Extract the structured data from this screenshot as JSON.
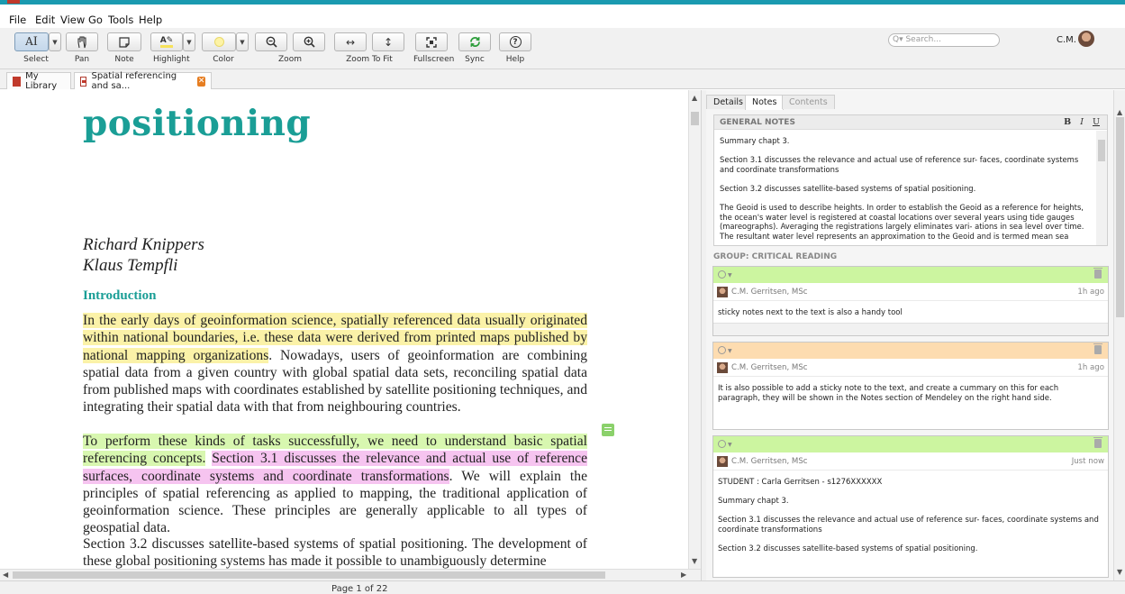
{
  "menu": [
    "File",
    "Edit",
    "View",
    "Go",
    "Tools",
    "Help"
  ],
  "toolbar": {
    "labels": {
      "select": "Select",
      "pan": "Pan",
      "note": "Note",
      "highlight": "Highlight",
      "color": "Color",
      "zoom": "Zoom",
      "zoom_to_fit": "Zoom To Fit",
      "fullscreen": "Fullscreen",
      "sync": "Sync",
      "help": "Help"
    },
    "search_placeholder": "Q▾ Search...",
    "user_initials": "C.M.",
    "colors": {
      "sync_icon": "#2e9e3c",
      "highlight_swatch": "#f7e25a",
      "color_swatch": "#fdf3a6"
    }
  },
  "tabs": {
    "library": "My Library",
    "document": "Spatial referencing and sa...",
    "close_glyph": "✕"
  },
  "document": {
    "title": "positioning",
    "author1": "Richard Knippers",
    "author2": "Klaus Tempfli",
    "heading": "Introduction",
    "p1_highlight": "In the early days of geoinformation science, spatially referenced data usually originated within national boundaries, i.e. these data were derived from printed maps published by national mapping organizations",
    "p1_rest": ". Nowadays, users of geoinformation are combining spatial data from a given country with global spatial data sets, reconciling spatial data from published maps with coordinates established by satellite positioning techniques, and integrating their spatial data with that from neighbouring countries.",
    "p2_green": "To perform these kinds of tasks successfully, we need to understand basic spatial referencing concepts.",
    "p2_pink": "Section 3.1 discusses the relevance and actual use of reference surfaces, coordinate systems and coordinate transformations",
    "p2_rest": ". We will explain the principles of spatial referencing as applied to mapping, the traditional application of geoinformation science. These principles are generally applicable to all types of geospatial data.",
    "p3": "Section 3.2 discusses satellite-based systems of spatial positioning. The development of these global positioning systems has made it possible to unambiguously determine",
    "highlight_colors": {
      "yellow": "#fbf2a8",
      "green": "#d8f7b0",
      "pink": "#f6c4f0"
    }
  },
  "status": {
    "page": "Page 1 of 22"
  },
  "sidebar": {
    "tabs": {
      "details": "Details",
      "notes": "Notes",
      "contents": "Contents"
    },
    "general_notes": {
      "title": "GENERAL NOTES",
      "format": {
        "bold": "B",
        "italic": "I",
        "underline": "U"
      },
      "lines": [
        "Summary chapt 3.",
        "Section 3.1 discusses the relevance and actual use of reference sur- faces, coordinate systems and coordinate transformations",
        "Section 3.2 discusses satellite-based systems of spatial positioning.",
        "The Geoid is used to describe heights. In order to establish the Geoid as a reference for heights, the ocean's water level is registered at coastal locations over several years using tide gauges (mareographs). Averaging the registrations largely eliminates vari- ations in sea level over time. The resultant water level represents an approximation to the Geoid and is termed mean sea level. The Geoid is used to describe heights. In order"
      ]
    },
    "group_title": "GROUP: CRITICAL READING",
    "cards": [
      {
        "color": "#ccf5a0",
        "author": "C.M. Gerritsen, MSc",
        "time": "1h ago",
        "lines": [
          "sticky notes next to the text is also a handy tool"
        ]
      },
      {
        "color": "#fddcb0",
        "author": "C.M. Gerritsen, MSc",
        "time": "1h ago",
        "lines": [
          "It is also possible to add a sticky note to the text, and create a cummary on this for each paragraph, they will be shown in the Notes section of Mendeley on the right hand side."
        ]
      },
      {
        "color": "#ccf5a0",
        "author": "C.M. Gerritsen, MSc",
        "time": "Just now",
        "lines": [
          "STUDENT : Carla Gerritsen - s1276XXXXXX",
          "Summary chapt 3.",
          "Section 3.1 discusses the relevance and actual use of reference sur- faces, coordinate systems and coordinate transformations",
          "Section 3.2 discusses satellite-based systems of spatial positioning."
        ]
      }
    ]
  }
}
